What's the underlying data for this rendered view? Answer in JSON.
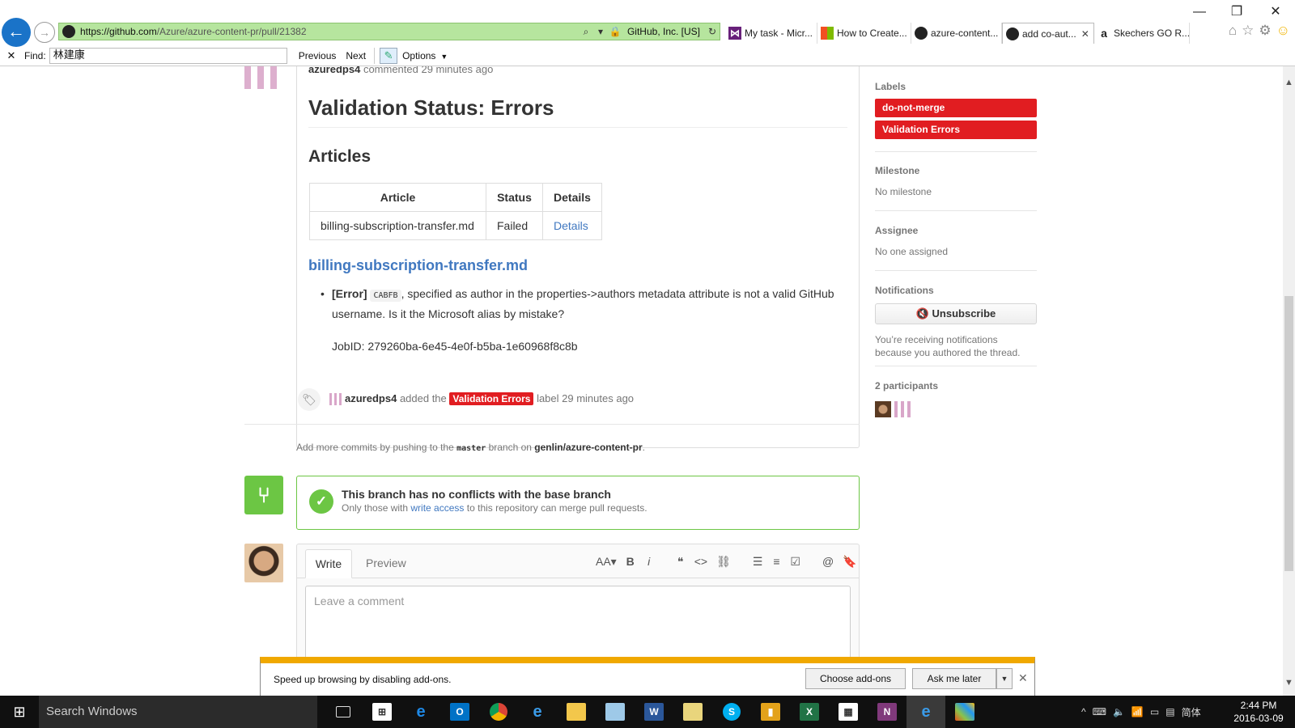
{
  "browser": {
    "url_prefix": "https://github.com",
    "url_path": "/Azure/azure-content-pr/pull/21382",
    "cert": "GitHub, Inc. [US]",
    "tabs": [
      {
        "label": "My task - Micr...",
        "color": "#68217a",
        "icon": "visual-studio-icon"
      },
      {
        "label": "How to Create...",
        "color": "#f25022",
        "icon": "microsoft-icon"
      },
      {
        "label": "azure-content...",
        "color": "#222222",
        "icon": "github-icon"
      },
      {
        "label": "add co-aut...",
        "color": "#222222",
        "icon": "github-icon"
      },
      {
        "label": "Skechers GO R...",
        "color": "#222222",
        "icon": "amazon-icon"
      }
    ],
    "find": {
      "close": "✕",
      "label": "Find:",
      "value": "林建康",
      "previous": "Previous",
      "next": "Next",
      "options": "Options"
    }
  },
  "comment": {
    "author": "azuredps4",
    "header_action": "commented 29 minutes ago",
    "title": "Validation Status: Errors",
    "articles_heading": "Articles",
    "table": {
      "headers": [
        "Article",
        "Status",
        "Details"
      ],
      "rows": [
        [
          "billing-subscription-transfer.md",
          "Failed",
          "Details"
        ]
      ]
    },
    "file_link": "billing-subscription-transfer.md",
    "error_tag": "[Error]",
    "error_code": "CABFB",
    "error_text": ", specified as author in the properties->authors metadata attribute is not a valid GitHub username. Is it the Microsoft alias by mistake?",
    "job_id": "JobID: 279260ba-6e45-4e0f-b5ba-1e60968f8c8b"
  },
  "event": {
    "author": "azuredps4",
    "added_the": "added the",
    "label": "Validation Errors",
    "suffix": "label 29 minutes ago"
  },
  "push_note": {
    "prefix": "Add more commits by pushing to the",
    "branch": "master",
    "middle": "branch on",
    "repo": "genlin/azure-content-pr",
    "end": "."
  },
  "merge": {
    "title": "This branch has no conflicts with the base branch",
    "sub_prefix": "Only those with",
    "sub_link": "write access",
    "sub_suffix": "to this repository can merge pull requests."
  },
  "editor": {
    "tab_write": "Write",
    "tab_preview": "Preview",
    "placeholder": "Leave a comment"
  },
  "sidebar": {
    "labels_heading": "Labels",
    "labels": [
      "do-not-merge",
      "Validation Errors"
    ],
    "label_color": "#e11d21",
    "milestone_heading": "Milestone",
    "milestone_value": "No milestone",
    "assignee_heading": "Assignee",
    "assignee_value": "No one assigned",
    "notifications_heading": "Notifications",
    "unsubscribe": "Unsubscribe",
    "notif_reason": "You’re receiving notifications because you authored the thread.",
    "participants_heading": "2 participants"
  },
  "notification_bar": {
    "text": "Speed up browsing by disabling add-ons.",
    "choose": "Choose add-ons",
    "later": "Ask me later"
  },
  "taskbar": {
    "search": "Search Windows",
    "time": "2:44 PM",
    "date": "2016-03-09",
    "ime": "简体"
  }
}
